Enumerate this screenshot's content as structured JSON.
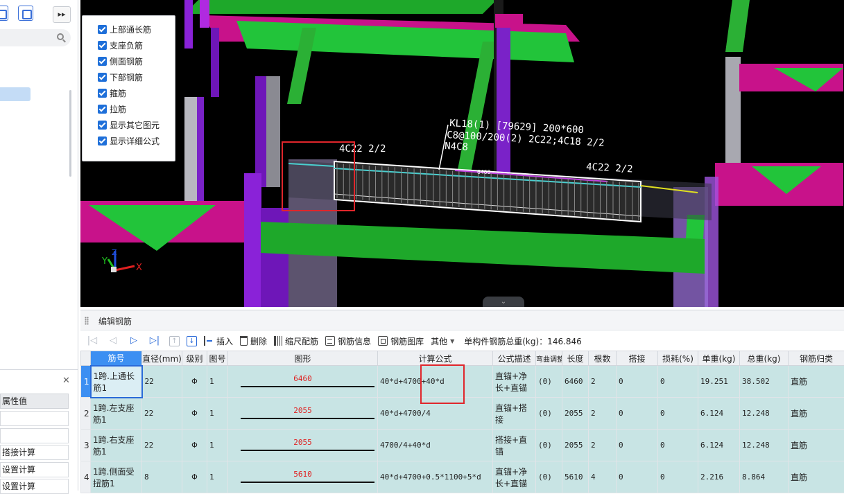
{
  "layer_panel": {
    "items": [
      {
        "label": "上部通长筋",
        "checked": true
      },
      {
        "label": "支座负筋",
        "checked": true
      },
      {
        "label": "侧面钢筋",
        "checked": true
      },
      {
        "label": "下部钢筋",
        "checked": true
      },
      {
        "label": "箍筋",
        "checked": true
      },
      {
        "label": "拉筋",
        "checked": true
      },
      {
        "label": "显示其它图元",
        "checked": true
      },
      {
        "label": "显示详细公式",
        "checked": true
      }
    ]
  },
  "viewport": {
    "beam_label_line1": "KL18(1) [79629] 200*600",
    "beam_label_line2": "C8@100/200(2) 2C22;4C18 2/2",
    "beam_label_line3": "N4C8",
    "left_support_label": "4C22 2/2",
    "right_support_label": "4C22 2/2",
    "beam_length_tag": "6460",
    "axis_x": "X",
    "axis_y": "Y",
    "axis_z": "Z",
    "collapse_glyph": "⌄"
  },
  "left_panel": {
    "expand_glyph": "▸▸",
    "close_glyph": "✕",
    "prop_header": "属性值",
    "prop_rows": [
      "",
      "",
      "搭接计算",
      "设置计算",
      "设置计算"
    ]
  },
  "editor": {
    "title": "编辑钢筋",
    "toolbar": {
      "insert": "插入",
      "delete": "删除",
      "scale_rebar": "缩尺配筋",
      "rebar_info": "钢筋信息",
      "rebar_library": "钢筋图库",
      "other": "其他",
      "total_weight_label": "单构件钢筋总重(kg)：146.846"
    },
    "columns": [
      "筋号",
      "直径(mm)",
      "级别",
      "图号",
      "图形",
      "计算公式",
      "公式描述",
      "弯曲调整",
      "长度",
      "根数",
      "搭接",
      "损耗(%)",
      "单重(kg)",
      "总重(kg)",
      "钢筋归类"
    ],
    "grade_symbol": "Φ",
    "rows": [
      {
        "idx": "1",
        "name": "1跨.上通长筋1",
        "dia": "22",
        "fig": "1",
        "shape": "6460",
        "formula": "40*d+4700+40*d",
        "desc": "直锚+净长+直锚",
        "bend": "(0)",
        "length": "6460",
        "count": "2",
        "lap": "0",
        "loss": "0",
        "unit_w": "19.251",
        "total_w": "38.502",
        "cat": "直筋"
      },
      {
        "idx": "2",
        "name": "1跨.左支座筋1",
        "dia": "22",
        "fig": "1",
        "shape": "2055",
        "formula": "40*d+4700/4",
        "desc": "直锚+搭接",
        "bend": "(0)",
        "length": "2055",
        "count": "2",
        "lap": "0",
        "loss": "0",
        "unit_w": "6.124",
        "total_w": "12.248",
        "cat": "直筋"
      },
      {
        "idx": "3",
        "name": "1跨.右支座筋1",
        "dia": "22",
        "fig": "1",
        "shape": "2055",
        "formula": "4700/4+40*d",
        "desc": "搭接+直锚",
        "bend": "(0)",
        "length": "2055",
        "count": "2",
        "lap": "0",
        "loss": "0",
        "unit_w": "6.124",
        "total_w": "12.248",
        "cat": "直筋"
      },
      {
        "idx": "4",
        "name": "1跨.侧面受扭筋1",
        "dia": "8",
        "fig": "1",
        "shape": "5610",
        "formula": "40*d+4700+0.5*1100+5*d",
        "desc": "直锚+净长+直锚",
        "bend": "(0)",
        "length": "5610",
        "count": "4",
        "lap": "0",
        "loss": "0",
        "unit_w": "2.216",
        "total_w": "8.864",
        "cat": "直筋"
      }
    ]
  }
}
